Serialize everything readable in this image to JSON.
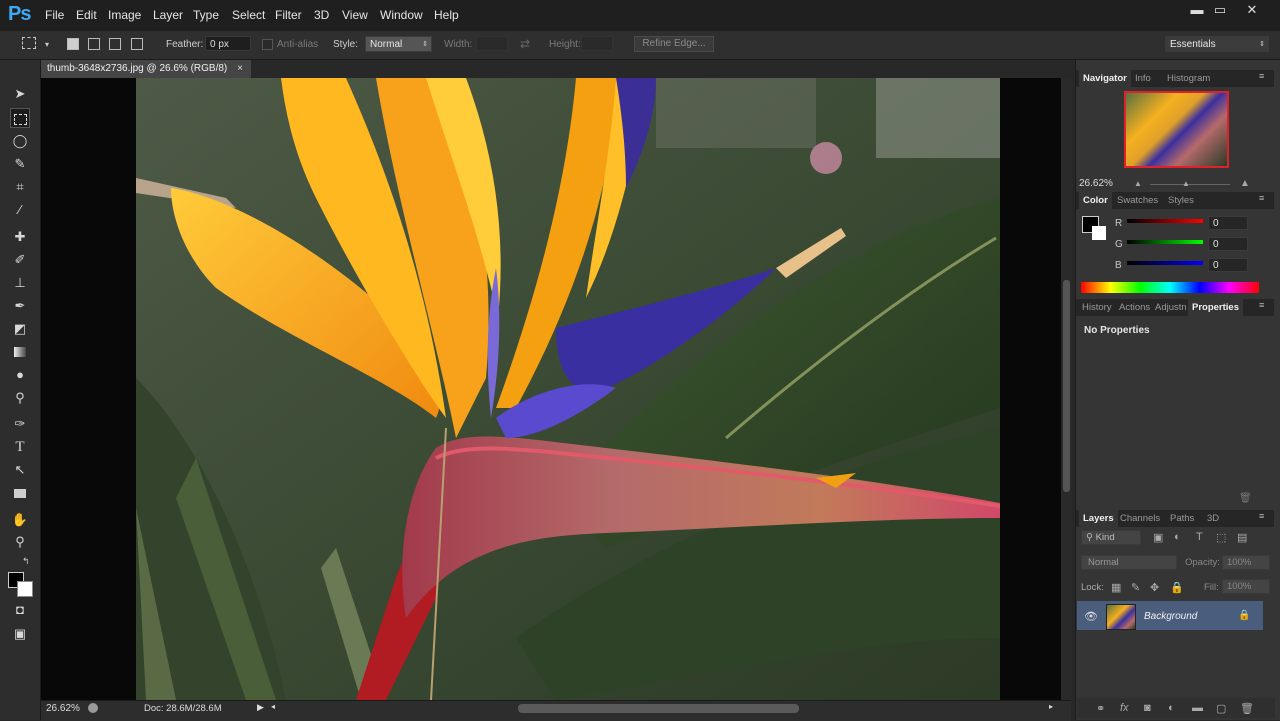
{
  "app": {
    "logo": "Ps"
  },
  "menu": [
    "File",
    "Edit",
    "Image",
    "Layer",
    "Type",
    "Select",
    "Filter",
    "3D",
    "View",
    "Window",
    "Help"
  ],
  "window_controls": {
    "minimize": "▬",
    "maximize": "▭",
    "close": "✕"
  },
  "options": {
    "feather_label": "Feather:",
    "feather_value": "0 px",
    "antialias_label": "Anti-alias",
    "style_label": "Style:",
    "style_value": "Normal",
    "width_label": "Width:",
    "height_label": "Height:",
    "refine_edge": "Refine Edge...",
    "workspace": "Essentials"
  },
  "document": {
    "tab_title": "thumb-3648x2736.jpg @ 26.6% (RGB/8)",
    "close": "×"
  },
  "status": {
    "zoom": "26.62%",
    "doc_info": "Doc: 28.6M/28.6M"
  },
  "panels": {
    "navigator_tabs": [
      "Navigator",
      "Info",
      "Histogram"
    ],
    "navigator_zoom": "26.62%",
    "color_tabs": [
      "Color",
      "Swatches",
      "Styles"
    ],
    "color": {
      "r_label": "R",
      "g_label": "G",
      "b_label": "B",
      "r": "0",
      "g": "0",
      "b": "0"
    },
    "props_tabs": [
      "History",
      "Actions",
      "Adjustn",
      "Properties"
    ],
    "no_properties": "No Properties",
    "layers_tabs": [
      "Layers",
      "Channels",
      "Paths",
      "3D"
    ],
    "kind": "Kind",
    "blend_mode": "Normal",
    "opacity_label": "Opacity:",
    "opacity_value": "100%",
    "lock_label": "Lock:",
    "fill_label": "Fill:",
    "fill_value": "100%",
    "layer_name": "Background"
  },
  "colors": {
    "accent": "#3fa9f5",
    "selected_layer": "#4b5d7d"
  }
}
